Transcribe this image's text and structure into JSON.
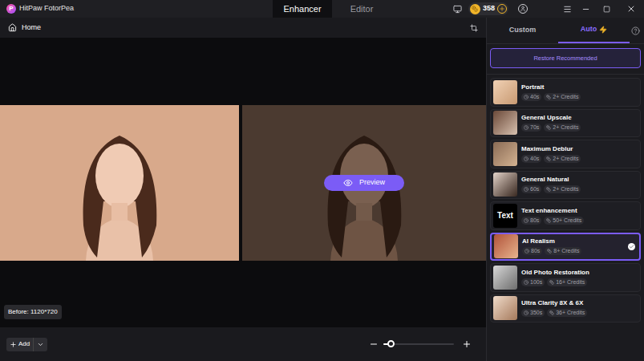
{
  "window": {
    "title": "HitPaw FotorPea",
    "logo": "P"
  },
  "tabs": [
    {
      "label": "Enhancer",
      "selected": true
    },
    {
      "label": "Editor",
      "selected": false
    }
  ],
  "coins": {
    "count": "358"
  },
  "toolbar": {
    "home": "Home"
  },
  "canvas": {
    "before_label": "Before: 1120*720",
    "preview_button": "Preview"
  },
  "bottom_bar": {
    "add_button": "Add",
    "zoom": {
      "level": 0.1
    }
  },
  "panel": {
    "tabs": [
      {
        "label": "Custom",
        "selected": false
      },
      {
        "label": "Auto",
        "selected": true
      }
    ],
    "restore_button": "Restore Recommended",
    "models": [
      {
        "name": "Portrait",
        "time": "40s",
        "credits": "2+ Credits",
        "selected": false,
        "thumb_label": ""
      },
      {
        "name": "General Upscale",
        "time": "70s",
        "credits": "2+ Credits",
        "selected": false,
        "thumb_label": ""
      },
      {
        "name": "Maximum Deblur",
        "time": "40s",
        "credits": "2+ Credits",
        "selected": false,
        "thumb_label": ""
      },
      {
        "name": "General Natural",
        "time": "60s",
        "credits": "2+ Credits",
        "selected": false,
        "thumb_label": ""
      },
      {
        "name": "Text enhancement",
        "time": "80s",
        "credits": "50+ Credits",
        "selected": false,
        "thumb_label": "Text"
      },
      {
        "name": "AI Realism",
        "time": "80s",
        "credits": "8+ Credits",
        "selected": true,
        "thumb_label": ""
      },
      {
        "name": "Old Photo Restoration",
        "time": "100s",
        "credits": "16+ Credits",
        "selected": false,
        "thumb_label": ""
      },
      {
        "name": "Ultra Clarity 8X & 6X",
        "time": "350s",
        "credits": "36+ Credits",
        "selected": false,
        "thumb_label": ""
      }
    ]
  }
}
